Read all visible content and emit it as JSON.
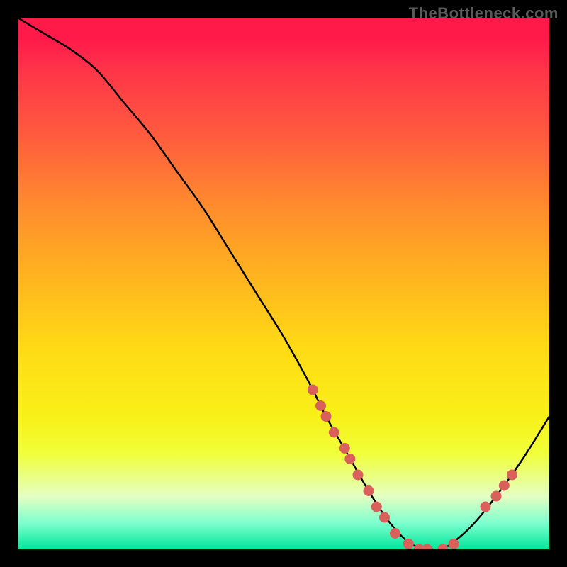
{
  "watermark": "TheBottleneck.com",
  "chart_data": {
    "type": "line",
    "title": "",
    "xlabel": "",
    "ylabel": "",
    "xlim": [
      0,
      100
    ],
    "ylim": [
      0,
      100
    ],
    "series": [
      {
        "name": "curve",
        "x": [
          0,
          5,
          10,
          15,
          20,
          25,
          30,
          35,
          40,
          45,
          50,
          55,
          58,
          62,
          66,
          70,
          74,
          78,
          80,
          85,
          90,
          95,
          100
        ],
        "y": [
          100,
          97,
          94,
          90,
          84,
          78,
          71,
          64,
          56,
          48,
          40,
          31,
          25,
          18,
          11,
          5,
          1,
          0,
          0,
          4,
          10,
          17,
          25
        ]
      }
    ],
    "markers": [
      {
        "x": 55.5,
        "y": 30
      },
      {
        "x": 57.0,
        "y": 27
      },
      {
        "x": 58.0,
        "y": 25
      },
      {
        "x": 59.5,
        "y": 22
      },
      {
        "x": 61.5,
        "y": 19
      },
      {
        "x": 62.5,
        "y": 17
      },
      {
        "x": 64.0,
        "y": 14
      },
      {
        "x": 66.0,
        "y": 11
      },
      {
        "x": 67.5,
        "y": 8
      },
      {
        "x": 69.0,
        "y": 6
      },
      {
        "x": 71.0,
        "y": 3
      },
      {
        "x": 73.5,
        "y": 1
      },
      {
        "x": 75.5,
        "y": 0
      },
      {
        "x": 77.0,
        "y": 0
      },
      {
        "x": 80.0,
        "y": 0
      },
      {
        "x": 82.0,
        "y": 1
      },
      {
        "x": 88.0,
        "y": 8
      },
      {
        "x": 90.0,
        "y": 10
      },
      {
        "x": 91.5,
        "y": 12
      },
      {
        "x": 93.0,
        "y": 14
      }
    ],
    "colors": {
      "curve": "#000000",
      "marker_fill": "#d9605b",
      "marker_stroke": "#d9605b"
    }
  }
}
